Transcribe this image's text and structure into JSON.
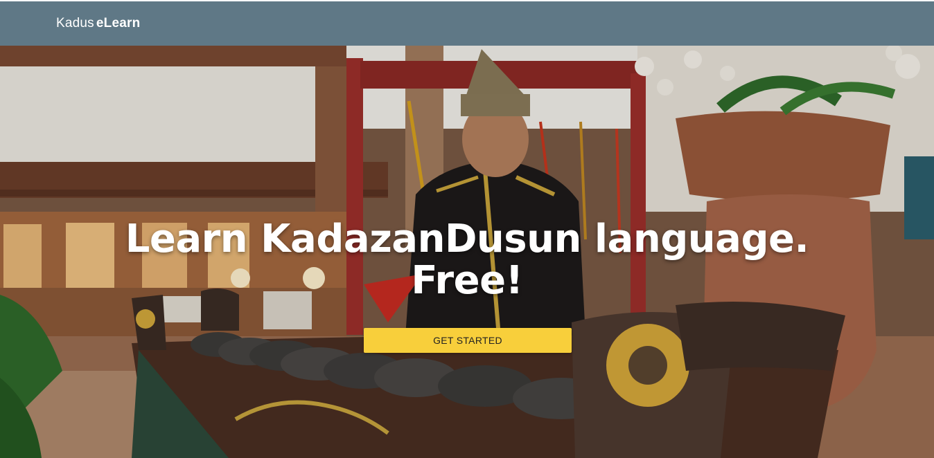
{
  "navbar": {
    "brand_light": "Kadus",
    "brand_bold": "eLearn",
    "background_color": "#5f7886"
  },
  "hero": {
    "title_line1": "Learn KadazanDusun language.",
    "title_line2": "Free!",
    "cta_label": "GET STARTED",
    "cta_color": "#f8cf3b",
    "background_image": "photo-of-man-in-traditional-attire-playing-gong-ensemble"
  }
}
